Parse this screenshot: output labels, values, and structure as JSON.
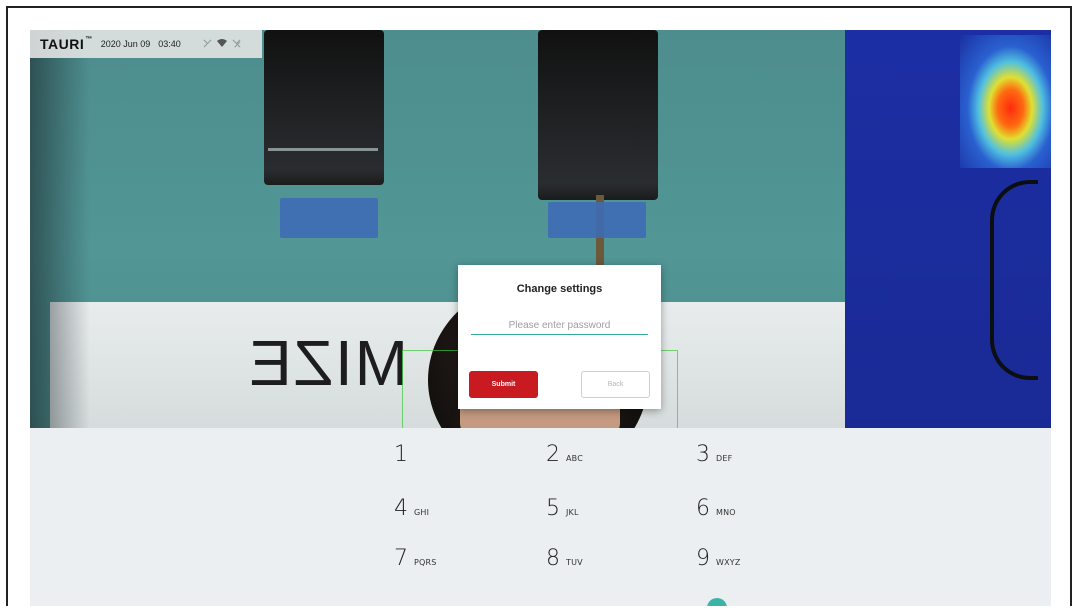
{
  "status_bar": {
    "brand": "TAURI",
    "brand_mark": "™",
    "date": "2020 Jun 09",
    "time": "03:40",
    "icons": [
      "signal-muted-icon",
      "wifi-icon",
      "no-signal-icon"
    ]
  },
  "dialog": {
    "title": "Change settings",
    "password_placeholder": "Please enter password",
    "password_value": "",
    "submit_label": "Submit",
    "back_label": "Back"
  },
  "wall_sign_text": "MIZE",
  "keypad": {
    "keys": [
      {
        "num": "1",
        "letters": ""
      },
      {
        "num": "2",
        "letters": "ABC"
      },
      {
        "num": "3",
        "letters": "DEF"
      },
      {
        "num": "4",
        "letters": "GHI"
      },
      {
        "num": "5",
        "letters": "JKL"
      },
      {
        "num": "6",
        "letters": "MNO"
      },
      {
        "num": "7",
        "letters": "PQRS"
      },
      {
        "num": "8",
        "letters": "TUV"
      },
      {
        "num": "9",
        "letters": "WXYZ"
      }
    ]
  },
  "colors": {
    "accent": "#36a89a",
    "submit": "#c91a22",
    "keypad_bg": "#eceff1"
  }
}
